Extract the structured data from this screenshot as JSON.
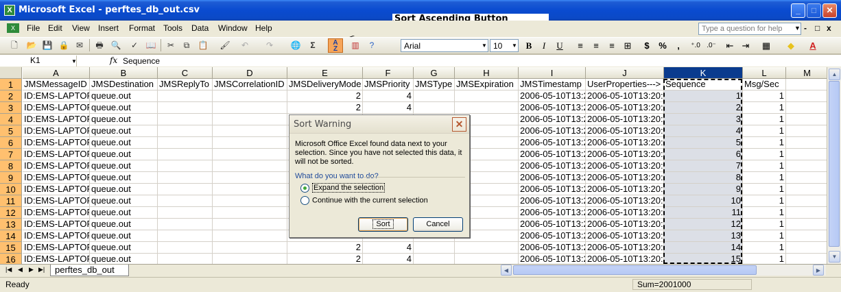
{
  "window": {
    "title": "Microsoft Excel - perftes_db_out.csv",
    "app_icon": "excel-icon",
    "controls": {
      "minimize": "_",
      "maximize": "□",
      "close": "✕"
    }
  },
  "annotation": {
    "callout": "Sort Ascending Button"
  },
  "menu": {
    "items": [
      "File",
      "Edit",
      "View",
      "Insert",
      "Format",
      "Tools",
      "Data",
      "Window",
      "Help"
    ],
    "help_placeholder": "Type a question for help",
    "doc_controls": {
      "minimize": "-",
      "restore": "□",
      "close": "x"
    }
  },
  "toolbar": {
    "font_name": "Arial",
    "font_size": "10",
    "bold": "B",
    "italic": "I",
    "underline": "U",
    "sigma": "Σ",
    "currency": "$",
    "percent": "%",
    "comma": ",",
    "sort_ascending": {
      "top": "A",
      "bottom": "Z"
    }
  },
  "formula_bar": {
    "name_box": "K1",
    "fx": "fx",
    "formula": "Sequence"
  },
  "grid": {
    "columns": [
      "A",
      "B",
      "C",
      "D",
      "E",
      "F",
      "G",
      "H",
      "I",
      "J",
      "K",
      "L",
      "M"
    ],
    "selected_column": "K",
    "header_row": [
      "JMSMessageID",
      "JMSDestination",
      "JMSReplyTo",
      "JMSCorrelationID",
      "JMSDeliveryMode",
      "JMSPriority",
      "JMSType",
      "JMSExpiration",
      "JMSTimestamp",
      "UserProperties--->",
      "Sequence",
      "Msg/Sec",
      ""
    ],
    "rows": [
      {
        "n": "1"
      },
      {
        "n": "2",
        "a": "ID:EMS-LAPTOP",
        "b": "queue.out",
        "e": "2",
        "f": "4",
        "i": "2006-05-10T13:2",
        "j": "2006-05-10T13:20:1",
        "k": "1",
        "l": "1"
      },
      {
        "n": "3",
        "a": "ID:EMS-LAPTOP",
        "b": "queue.out",
        "e": "2",
        "f": "4",
        "i": "2006-05-10T13:2",
        "j": "2006-05-10T13:20:1",
        "k": "2",
        "l": "1"
      },
      {
        "n": "4",
        "a": "ID:EMS-LAPTOP",
        "b": "queue.out",
        "e": "",
        "f": "",
        "i": "2006-05-10T13:2",
        "j": "2006-05-10T13:20:1",
        "k": "3",
        "l": "1"
      },
      {
        "n": "5",
        "a": "ID:EMS-LAPTOP",
        "b": "queue.out",
        "e": "",
        "f": "",
        "i": "2006-05-10T13:2",
        "j": "2006-05-10T13:20:1",
        "k": "4",
        "l": "1"
      },
      {
        "n": "6",
        "a": "ID:EMS-LAPTOP",
        "b": "queue.out",
        "e": "",
        "f": "",
        "i": "2006-05-10T13:2",
        "j": "2006-05-10T13:20:1",
        "k": "5",
        "l": "1"
      },
      {
        "n": "7",
        "a": "ID:EMS-LAPTOP",
        "b": "queue.out",
        "e": "",
        "f": "",
        "i": "2006-05-10T13:2",
        "j": "2006-05-10T13:20:2",
        "k": "6",
        "l": "1"
      },
      {
        "n": "8",
        "a": "ID:EMS-LAPTOP",
        "b": "queue.out",
        "e": "",
        "f": "",
        "i": "2006-05-10T13:2",
        "j": "2006-05-10T13:20:2",
        "k": "7",
        "l": "1"
      },
      {
        "n": "9",
        "a": "ID:EMS-LAPTOP",
        "b": "queue.out",
        "e": "",
        "f": "",
        "i": "2006-05-10T13:2",
        "j": "2006-05-10T13:20:2",
        "k": "8",
        "l": "1"
      },
      {
        "n": "10",
        "a": "ID:EMS-LAPTOP",
        "b": "queue.out",
        "e": "",
        "f": "",
        "i": "2006-05-10T13:2",
        "j": "2006-05-10T13:20:2",
        "k": "9",
        "l": "1"
      },
      {
        "n": "11",
        "a": "ID:EMS-LAPTOP",
        "b": "queue.out",
        "e": "",
        "f": "",
        "i": "2006-05-10T13:2",
        "j": "2006-05-10T13:20:2",
        "k": "10",
        "l": "1"
      },
      {
        "n": "12",
        "a": "ID:EMS-LAPTOP",
        "b": "queue.out",
        "e": "",
        "f": "",
        "i": "2006-05-10T13:2",
        "j": "2006-05-10T13:20:2",
        "k": "11",
        "l": "1"
      },
      {
        "n": "13",
        "a": "ID:EMS-LAPTOP",
        "b": "queue.out",
        "e": "",
        "f": "",
        "i": "2006-05-10T13:2",
        "j": "2006-05-10T13:20:2",
        "k": "12",
        "l": "1"
      },
      {
        "n": "14",
        "a": "ID:EMS-LAPTOP",
        "b": "queue.out",
        "e": "",
        "f": "",
        "i": "2006-05-10T13:2",
        "j": "2006-05-10T13:20:2",
        "k": "13",
        "l": "1"
      },
      {
        "n": "15",
        "a": "ID:EMS-LAPTOP",
        "b": "queue.out",
        "e": "2",
        "f": "4",
        "i": "2006-05-10T13:2",
        "j": "2006-05-10T13:20:2",
        "k": "14",
        "l": "1"
      },
      {
        "n": "16",
        "a": "ID:EMS-LAPTOP",
        "b": "queue.out",
        "e": "2",
        "f": "4",
        "i": "2006-05-10T13:2",
        "j": "2006-05-10T13:20:2",
        "k": "15",
        "l": "1"
      }
    ]
  },
  "sheet_tab": {
    "label": "perftes_db_out"
  },
  "status": {
    "ready": "Ready",
    "sum": "Sum=2001000"
  },
  "dialog": {
    "title": "Sort Warning",
    "message": "Microsoft Office Excel found data next to your selection.  Since you have not selected this data, it will not be sorted.",
    "question": "What do you want to do?",
    "option_expand": "Expand the selection",
    "option_continue": "Continue with the current selection",
    "sort_label": "Sort",
    "cancel_label": "Cancel"
  },
  "colors": {
    "title_bar": "#0A4BD0",
    "selected_header": "#0A3B8E",
    "row_header": "#FFC06F",
    "sort_button": "#F6A55A"
  }
}
